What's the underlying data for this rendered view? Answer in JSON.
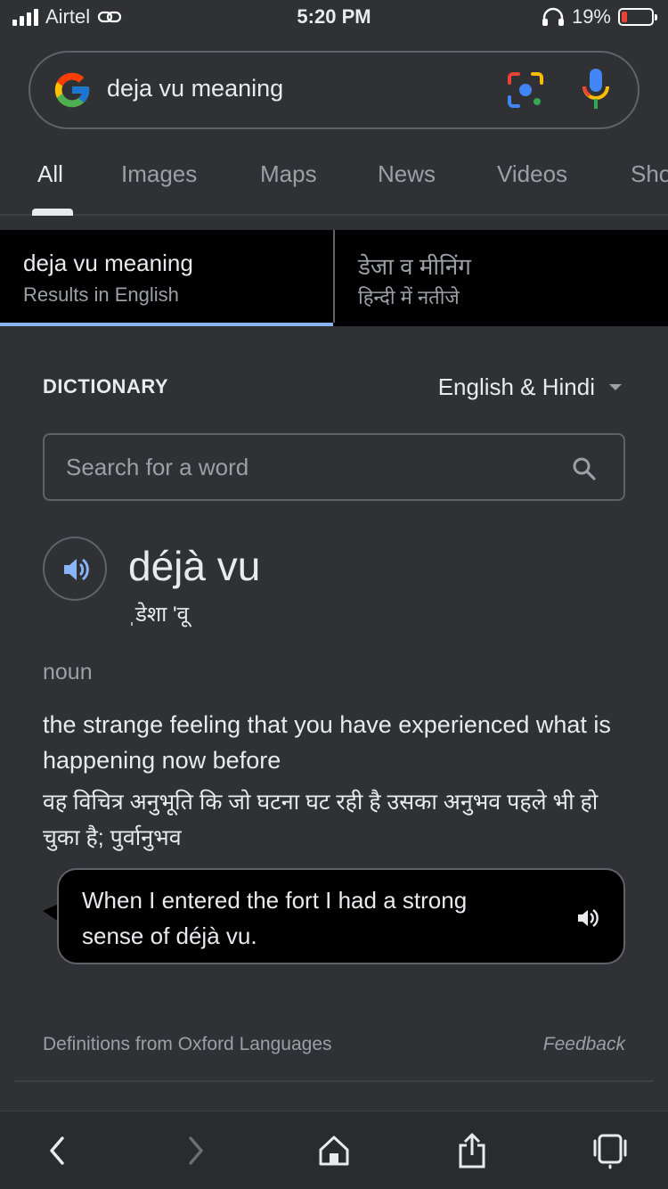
{
  "status_bar": {
    "carrier": "Airtel",
    "time": "5:20 PM",
    "battery_percent": "19%",
    "battery_level": 0.19,
    "icons": [
      "signal-icon",
      "hotspot-link-icon",
      "headphones-icon",
      "battery-icon"
    ]
  },
  "search": {
    "query": "deja vu meaning",
    "icons": [
      "google-logo",
      "lens-icon",
      "mic-icon"
    ]
  },
  "tabs": [
    {
      "label": "All",
      "active": true
    },
    {
      "label": "Images"
    },
    {
      "label": "Maps"
    },
    {
      "label": "News"
    },
    {
      "label": "Videos"
    },
    {
      "label": "Sho"
    }
  ],
  "language_options": [
    {
      "primary": "deja vu meaning",
      "secondary": "Results in English",
      "selected": true
    },
    {
      "primary": "डेजा व मीनिंग",
      "secondary": "हिन्दी में नतीजे",
      "selected": false
    }
  ],
  "dictionary": {
    "title": "DICTIONARY",
    "language_select": "English & Hindi",
    "search_placeholder": "Search for a word",
    "headword": "déjà vu",
    "pronunciation": "ˌडेशा 'वू",
    "part_of_speech": "noun",
    "definition_en": "the strange feeling that you have experienced what is happening now before",
    "definition_hi": "वह विचित्र अनुभूति कि जो घटना घट रही है उसका अनुभव पहले भी हो चुका है; पुर्वानुभव",
    "example": "When I entered the fort I had a strong sense of déjà vu.",
    "source": "Definitions from Oxford Languages",
    "feedback": "Feedback"
  },
  "toolbar": {
    "icons": [
      "back-icon",
      "forward-icon",
      "home-icon",
      "share-icon",
      "tabs-icon"
    ]
  },
  "colors": {
    "background": "#303134",
    "accent_blue": "#8ab4f8",
    "text_primary": "#e8eaed",
    "text_secondary": "#9aa0a6",
    "battery_low": "#ea4335"
  }
}
